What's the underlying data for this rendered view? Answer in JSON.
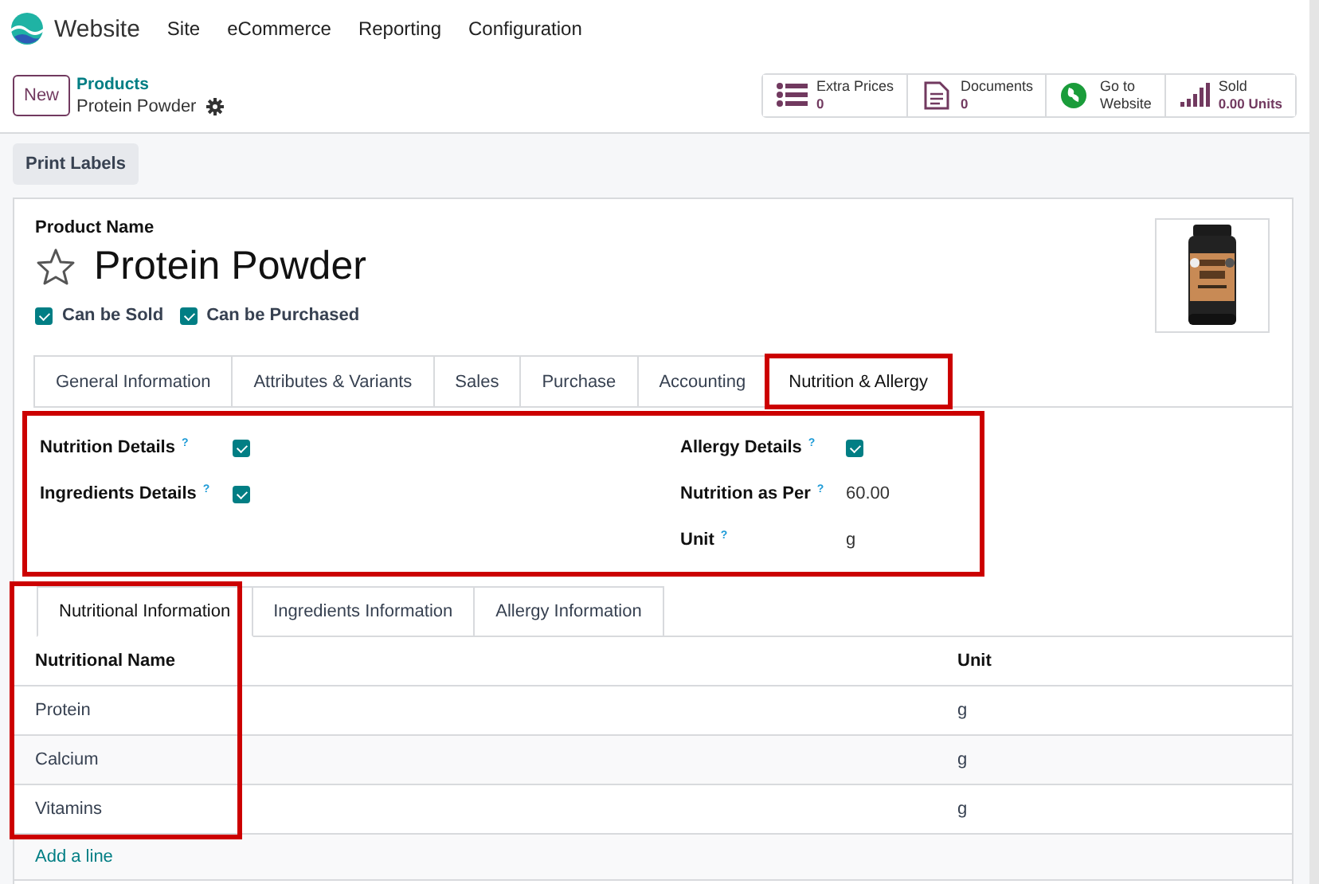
{
  "navbar": {
    "app": "Website",
    "menus": [
      "Site",
      "eCommerce",
      "Reporting",
      "Configuration"
    ]
  },
  "control_panel": {
    "new_button": "New",
    "breadcrumb": "Products",
    "record": "Protein Powder",
    "smart_buttons": [
      {
        "kind": "list",
        "label": "Extra Prices",
        "value": "0"
      },
      {
        "kind": "document",
        "label": "Documents",
        "value": "0"
      },
      {
        "kind": "globe",
        "label": "Go to",
        "value": "Website"
      },
      {
        "kind": "chart",
        "label": "Sold",
        "value": "0.00 Units"
      }
    ]
  },
  "action_button": "Print Labels",
  "form": {
    "name_label": "Product Name",
    "name": "Protein Powder",
    "favorite": false,
    "options": [
      {
        "label": "Can be Sold",
        "checked": true
      },
      {
        "label": "Can be Purchased",
        "checked": true
      }
    ],
    "tabs": [
      {
        "label": "General Information",
        "selected": false,
        "highlighted": false
      },
      {
        "label": "Attributes & Variants",
        "selected": false,
        "highlighted": false
      },
      {
        "label": "Sales",
        "selected": false,
        "highlighted": false
      },
      {
        "label": "Purchase",
        "selected": false,
        "highlighted": false
      },
      {
        "label": "Accounting",
        "selected": false,
        "highlighted": false
      },
      {
        "label": "Nutrition & Allergy",
        "selected": true,
        "highlighted": true
      }
    ],
    "details_highlighted": true,
    "left_fields": [
      {
        "kind": "check",
        "label": "Nutrition Details",
        "help": "?",
        "checked": true
      },
      {
        "kind": "check",
        "label": "Ingredients Details",
        "help": "?",
        "checked": true
      }
    ],
    "right_fields": [
      {
        "kind": "check",
        "label": "Allergy Details",
        "help": "?",
        "checked": true
      },
      {
        "kind": "text",
        "label": "Nutrition as Per",
        "help": "?",
        "value": "60.00"
      },
      {
        "kind": "text",
        "label": "Unit",
        "help": "?",
        "value": "g"
      }
    ],
    "subtabs": [
      {
        "label": "Nutritional Information",
        "selected": true
      },
      {
        "label": "Ingredients Information",
        "selected": false
      },
      {
        "label": "Allergy Information",
        "selected": false
      }
    ],
    "table": {
      "columns": [
        {
          "label": "Nutritional Name",
          "highlighted": true
        },
        {
          "label": "Unit",
          "highlighted": false
        }
      ],
      "rows": [
        [
          "Protein",
          "g"
        ],
        [
          "Calcium",
          "g"
        ],
        [
          "Vitamins",
          "g"
        ]
      ],
      "add_line": "Add a line"
    }
  }
}
